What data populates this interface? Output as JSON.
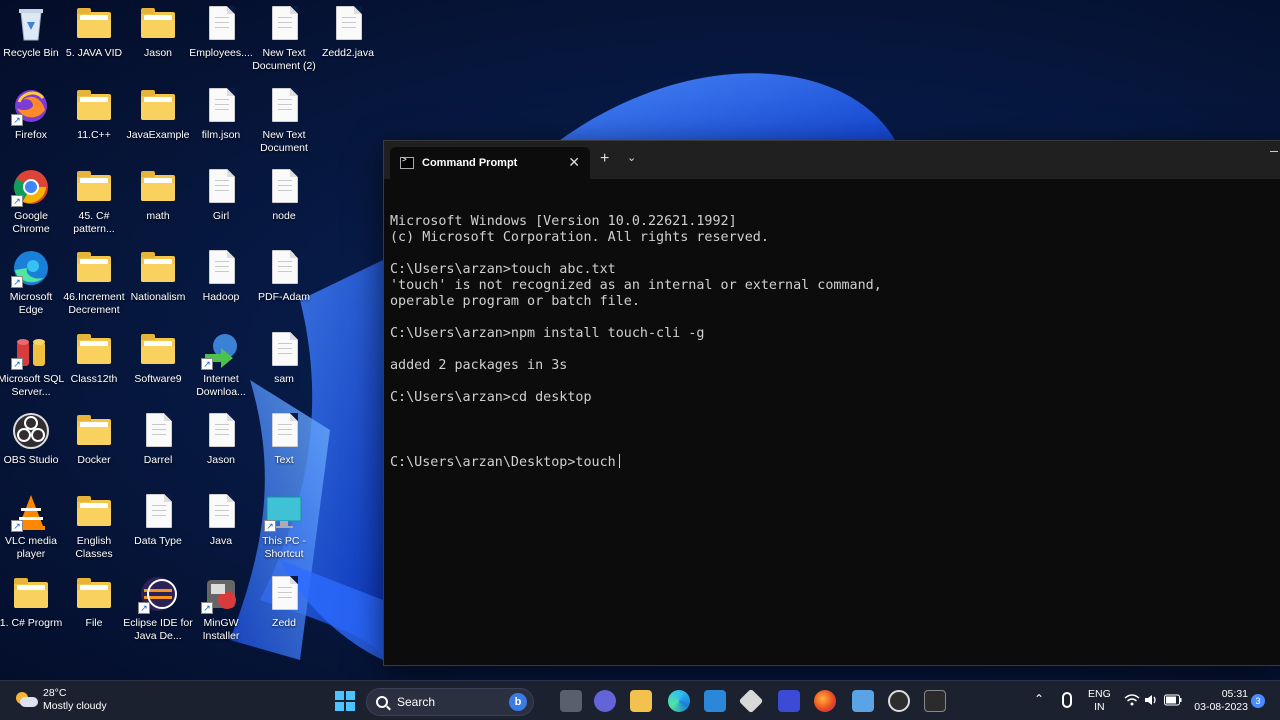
{
  "desktop": {
    "icons": [
      {
        "label": "Recycle Bin",
        "type": "recycle"
      },
      {
        "label": "5. JAVA VID",
        "type": "folder"
      },
      {
        "label": "Jason",
        "type": "folder"
      },
      {
        "label": "Employees....",
        "type": "doc"
      },
      {
        "label": "New Text Document (2)",
        "type": "doc"
      },
      {
        "label": "Zedd2.java",
        "type": "doc"
      },
      {
        "label": "Firefox",
        "type": "firefox"
      },
      {
        "label": "11.C++",
        "type": "folder"
      },
      {
        "label": "JavaExample",
        "type": "folder"
      },
      {
        "label": "film.json",
        "type": "doc"
      },
      {
        "label": "New Text Document",
        "type": "doc"
      },
      {
        "label": "Google Chrome",
        "type": "chrome"
      },
      {
        "label": "45. C# pattern...",
        "type": "folder"
      },
      {
        "label": "math",
        "type": "folder"
      },
      {
        "label": "Girl",
        "type": "doc"
      },
      {
        "label": "node",
        "type": "doc"
      },
      {
        "label": "Microsoft Edge",
        "type": "edge"
      },
      {
        "label": "46.Increment Decrement",
        "type": "folder"
      },
      {
        "label": "Nationalism",
        "type": "folder"
      },
      {
        "label": "Hadoop",
        "type": "doc"
      },
      {
        "label": "PDF-Adam",
        "type": "doc"
      },
      {
        "label": "Microsoft SQL Server...",
        "type": "sqlserver"
      },
      {
        "label": "Class12th",
        "type": "folder"
      },
      {
        "label": "Software9",
        "type": "folder"
      },
      {
        "label": "Internet Downloa...",
        "type": "idm"
      },
      {
        "label": "sam",
        "type": "doc"
      },
      {
        "label": "OBS Studio",
        "type": "obs"
      },
      {
        "label": "Docker",
        "type": "folder"
      },
      {
        "label": "Darrel",
        "type": "doc"
      },
      {
        "label": "Jason",
        "type": "doc"
      },
      {
        "label": "Text",
        "type": "doc"
      },
      {
        "label": "VLC media player",
        "type": "vlc"
      },
      {
        "label": "English Classes",
        "type": "folder"
      },
      {
        "label": "Data Type",
        "type": "doc"
      },
      {
        "label": "Java",
        "type": "doc"
      },
      {
        "label": "This PC - Shortcut",
        "type": "thispc"
      },
      {
        "label": "1. C# Progrm",
        "type": "folder"
      },
      {
        "label": "File",
        "type": "folder"
      },
      {
        "label": "Eclipse IDE for Java De...",
        "type": "eclipse"
      },
      {
        "label": "MinGW Installer",
        "type": "mingw"
      },
      {
        "label": "Zedd",
        "type": "doc"
      }
    ]
  },
  "cmd_window": {
    "tab_title": "Command Prompt",
    "close_glyph": "✕",
    "new_tab_glyph": "+",
    "dropdown_glyph": "⌄",
    "lines": [
      "Microsoft Windows [Version 10.0.22621.1992]",
      "(c) Microsoft Corporation. All rights reserved.",
      "",
      "C:\\Users\\arzan>touch abc.txt",
      "'touch' is not recognized as an internal or external command,",
      "operable program or batch file.",
      "",
      "C:\\Users\\arzan>npm install touch-cli -g",
      "",
      "added 2 packages in 3s",
      "",
      "C:\\Users\\arzan>cd desktop",
      ""
    ],
    "current_prompt": "C:\\Users\\arzan\\Desktop>touch"
  },
  "taskbar": {
    "weather": {
      "temp": "28°C",
      "condition": "Mostly cloudy"
    },
    "search_placeholder": "Search",
    "bing_letter": "b",
    "apps": [
      "start-icon",
      "search",
      "task-view-icon",
      "teams-chat-icon",
      "file-explorer-icon",
      "edge-icon",
      "store-icon",
      "unity-icon",
      "visual-studio-icon",
      "firefox-icon",
      "notepad-icon",
      "obs-icon",
      "terminal-icon"
    ],
    "tray": {
      "language": "ENG",
      "region": "IN",
      "time": "05:31",
      "date": "03-08-2023",
      "notification_count": "3"
    }
  },
  "colors": {
    "console_bg": "#0c0c0c",
    "console_text": "#d0d0d0",
    "titlebar_bg": "#202020",
    "taskbar_bg": "#1c2130",
    "wallpaper_blue": "#1f5bff"
  }
}
